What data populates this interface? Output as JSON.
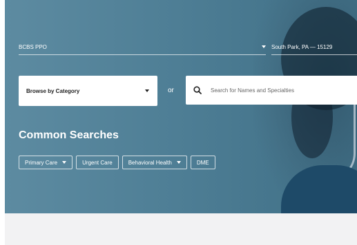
{
  "plan": {
    "selected": "BCBS PPO"
  },
  "location": {
    "value": "South Park, PA — 15129"
  },
  "browse": {
    "label": "Browse by Category"
  },
  "or_label": "or",
  "search": {
    "placeholder": "Search for Names and Specialties"
  },
  "common_searches": {
    "title": "Common Searches",
    "chips": [
      {
        "label": "Primary Care",
        "has_dropdown": true
      },
      {
        "label": "Urgent Care",
        "has_dropdown": false
      },
      {
        "label": "Behavioral Health",
        "has_dropdown": true
      },
      {
        "label": "DME",
        "has_dropdown": false
      }
    ]
  },
  "colors": {
    "hero_bg": "#4f7f96",
    "footer_bg": "#f2f2f3",
    "text_on_hero": "#ffffff"
  }
}
